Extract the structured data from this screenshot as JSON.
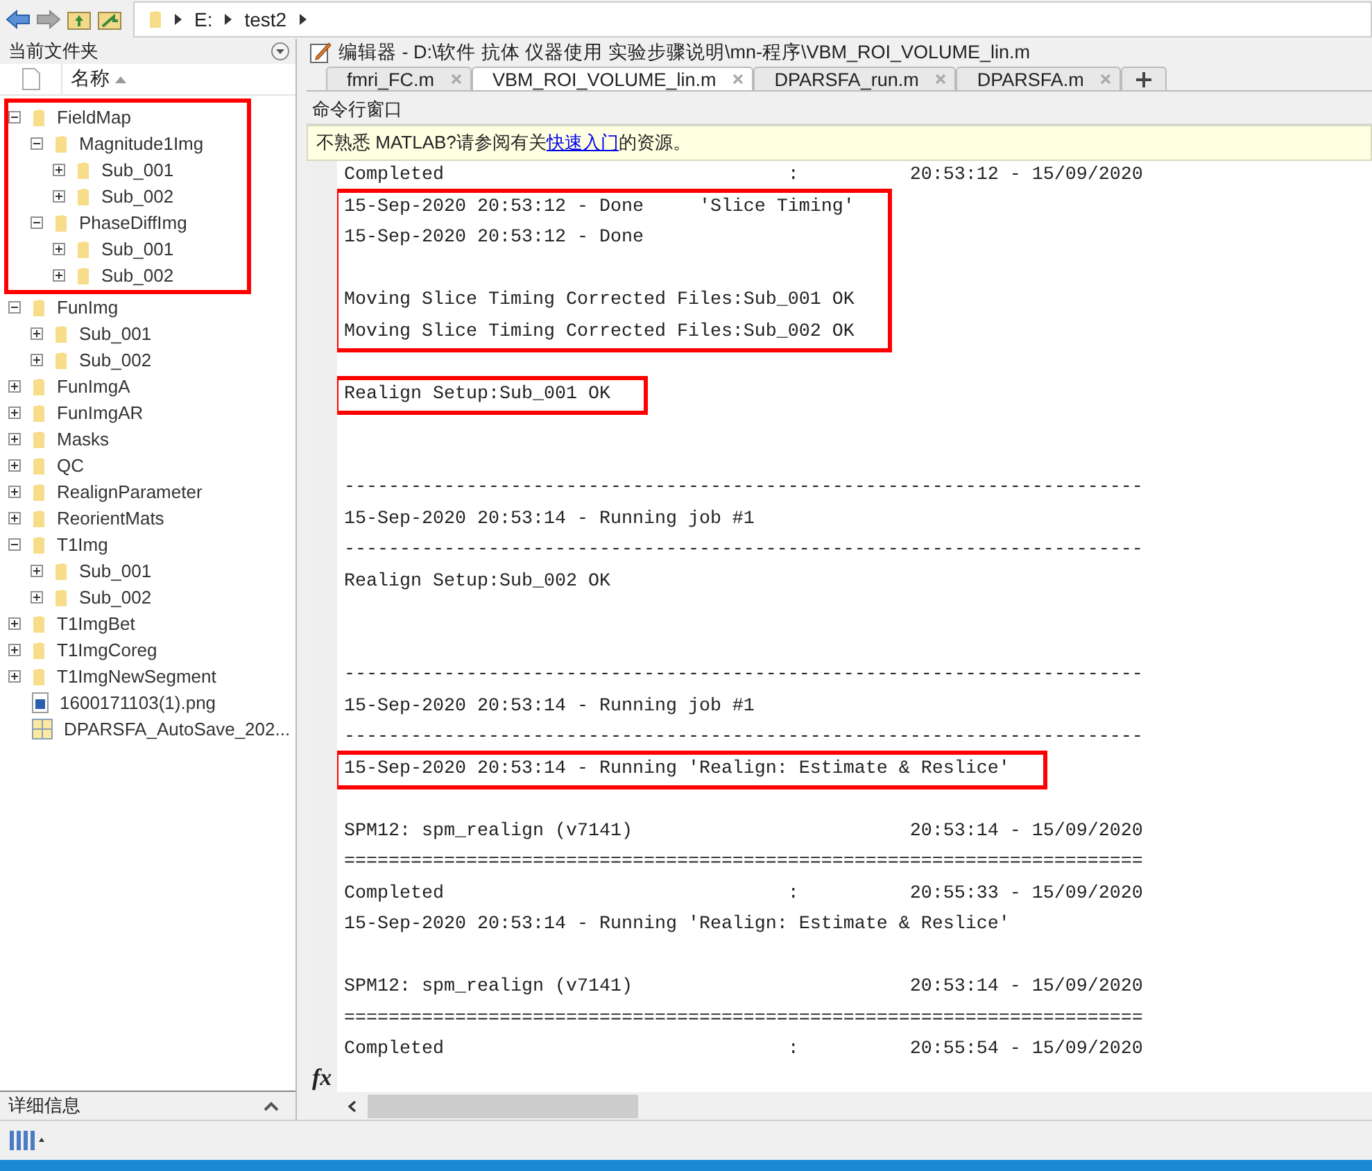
{
  "toolbar": {
    "address": [
      "E:",
      "test2"
    ]
  },
  "folder_panel": {
    "title": "当前文件夹",
    "column": "名称",
    "tree": [
      {
        "label": "FieldMap",
        "kind": "folder",
        "expanded": true,
        "highlighted": true,
        "children": [
          {
            "label": "Magnitude1Img",
            "kind": "folder",
            "expanded": true,
            "children": [
              {
                "label": "Sub_001",
                "kind": "folder",
                "expanded": false
              },
              {
                "label": "Sub_002",
                "kind": "folder",
                "expanded": false
              }
            ]
          },
          {
            "label": "PhaseDiffImg",
            "kind": "folder",
            "expanded": true,
            "children": [
              {
                "label": "Sub_001",
                "kind": "folder",
                "expanded": false
              },
              {
                "label": "Sub_002",
                "kind": "folder",
                "expanded": false
              }
            ]
          }
        ]
      },
      {
        "label": "FunImg",
        "kind": "folder",
        "expanded": true,
        "highlighted": false,
        "children": [
          {
            "label": "Sub_001",
            "kind": "folder",
            "expanded": false
          },
          {
            "label": "Sub_002",
            "kind": "folder",
            "expanded": false
          }
        ]
      },
      {
        "label": "FunImgA",
        "kind": "folder",
        "expanded": false,
        "highlighted": false
      },
      {
        "label": "FunImgAR",
        "kind": "folder",
        "expanded": false,
        "highlighted": false
      },
      {
        "label": "Masks",
        "kind": "folder",
        "expanded": false,
        "highlighted": false
      },
      {
        "label": "QC",
        "kind": "folder",
        "expanded": false,
        "highlighted": false
      },
      {
        "label": "RealignParameter",
        "kind": "folder",
        "expanded": false,
        "highlighted": false
      },
      {
        "label": "ReorientMats",
        "kind": "folder",
        "expanded": false,
        "highlighted": false
      },
      {
        "label": "T1Img",
        "kind": "folder",
        "expanded": true,
        "highlighted": false,
        "children": [
          {
            "label": "Sub_001",
            "kind": "folder",
            "expanded": false
          },
          {
            "label": "Sub_002",
            "kind": "folder",
            "expanded": false
          }
        ]
      },
      {
        "label": "T1ImgBet",
        "kind": "folder",
        "expanded": false,
        "highlighted": false
      },
      {
        "label": "T1ImgCoreg",
        "kind": "folder",
        "expanded": false,
        "highlighted": false
      },
      {
        "label": "T1ImgNewSegment",
        "kind": "folder",
        "expanded": false,
        "highlighted": false
      },
      {
        "label": "1600171103(1).png",
        "kind": "image",
        "highlighted": false
      },
      {
        "label": "DPARSFA_AutoSave_202...",
        "kind": "table",
        "highlighted": false
      }
    ],
    "details": "详细信息"
  },
  "editor": {
    "title": "编辑器 - D:\\软件 抗体 仪器使用 实验步骤说明\\mn-程序\\VBM_ROI_VOLUME_lin.m",
    "tabs": [
      {
        "label": "fmri_FC.m",
        "selected": false
      },
      {
        "label": "VBM_ROI_VOLUME_lin.m",
        "selected": true
      },
      {
        "label": "DPARSFA_run.m",
        "selected": false
      },
      {
        "label": "DPARSFA.m",
        "selected": false
      }
    ]
  },
  "command_window": {
    "title": "命令行窗口",
    "notice": {
      "before": "不熟悉 MATLAB?请参阅有关",
      "link": "快速入门",
      "after": "的资源。"
    },
    "prompt": "fx",
    "lines": [
      {
        "kind": "text",
        "text": "Completed                               :          20:53:12 - 15/09/2020"
      },
      {
        "kind": "highlight",
        "lines": [
          {
            "kind": "text",
            "text": "15-Sep-2020 20:53:12 - Done     'Slice Timing'"
          },
          {
            "kind": "text",
            "text": "15-Sep-2020 20:53:12 - Done"
          },
          {
            "kind": "blank"
          },
          {
            "kind": "text",
            "text": "Moving Slice Timing Corrected Files:Sub_001 OK"
          },
          {
            "kind": "text",
            "text": "Moving Slice Timing Corrected Files:Sub_002 OK"
          }
        ]
      },
      {
        "kind": "blank"
      },
      {
        "kind": "highlight",
        "lines": [
          {
            "kind": "text",
            "text": "Realign Setup:Sub_001 OK"
          }
        ]
      },
      {
        "kind": "blank"
      },
      {
        "kind": "blank"
      },
      {
        "kind": "text",
        "text": "------------------------------------------------------------------------"
      },
      {
        "kind": "text",
        "text": "15-Sep-2020 20:53:14 - Running job #1"
      },
      {
        "kind": "text",
        "text": "------------------------------------------------------------------------"
      },
      {
        "kind": "text",
        "text": "Realign Setup:Sub_002 OK"
      },
      {
        "kind": "blank"
      },
      {
        "kind": "blank"
      },
      {
        "kind": "text",
        "text": "------------------------------------------------------------------------"
      },
      {
        "kind": "text",
        "text": "15-Sep-2020 20:53:14 - Running job #1"
      },
      {
        "kind": "text",
        "text": "------------------------------------------------------------------------"
      },
      {
        "kind": "highlight",
        "lines": [
          {
            "kind": "text",
            "text": "15-Sep-2020 20:53:14 - Running 'Realign: Estimate & Reslice'"
          }
        ]
      },
      {
        "kind": "blank"
      },
      {
        "kind": "text",
        "text": "SPM12: spm_realign (v7141)                         20:53:14 - 15/09/2020"
      },
      {
        "kind": "text",
        "text": "========================================================================"
      },
      {
        "kind": "text",
        "text": "Completed                               :          20:55:33 - 15/09/2020"
      },
      {
        "kind": "text",
        "text": "15-Sep-2020 20:53:14 - Running 'Realign: Estimate & Reslice'"
      },
      {
        "kind": "blank"
      },
      {
        "kind": "text",
        "text": "SPM12: spm_realign (v7141)                         20:53:14 - 15/09/2020"
      },
      {
        "kind": "text",
        "text": "========================================================================"
      },
      {
        "kind": "text",
        "text": "Completed                               :          20:55:54 - 15/09/2020"
      }
    ]
  }
}
